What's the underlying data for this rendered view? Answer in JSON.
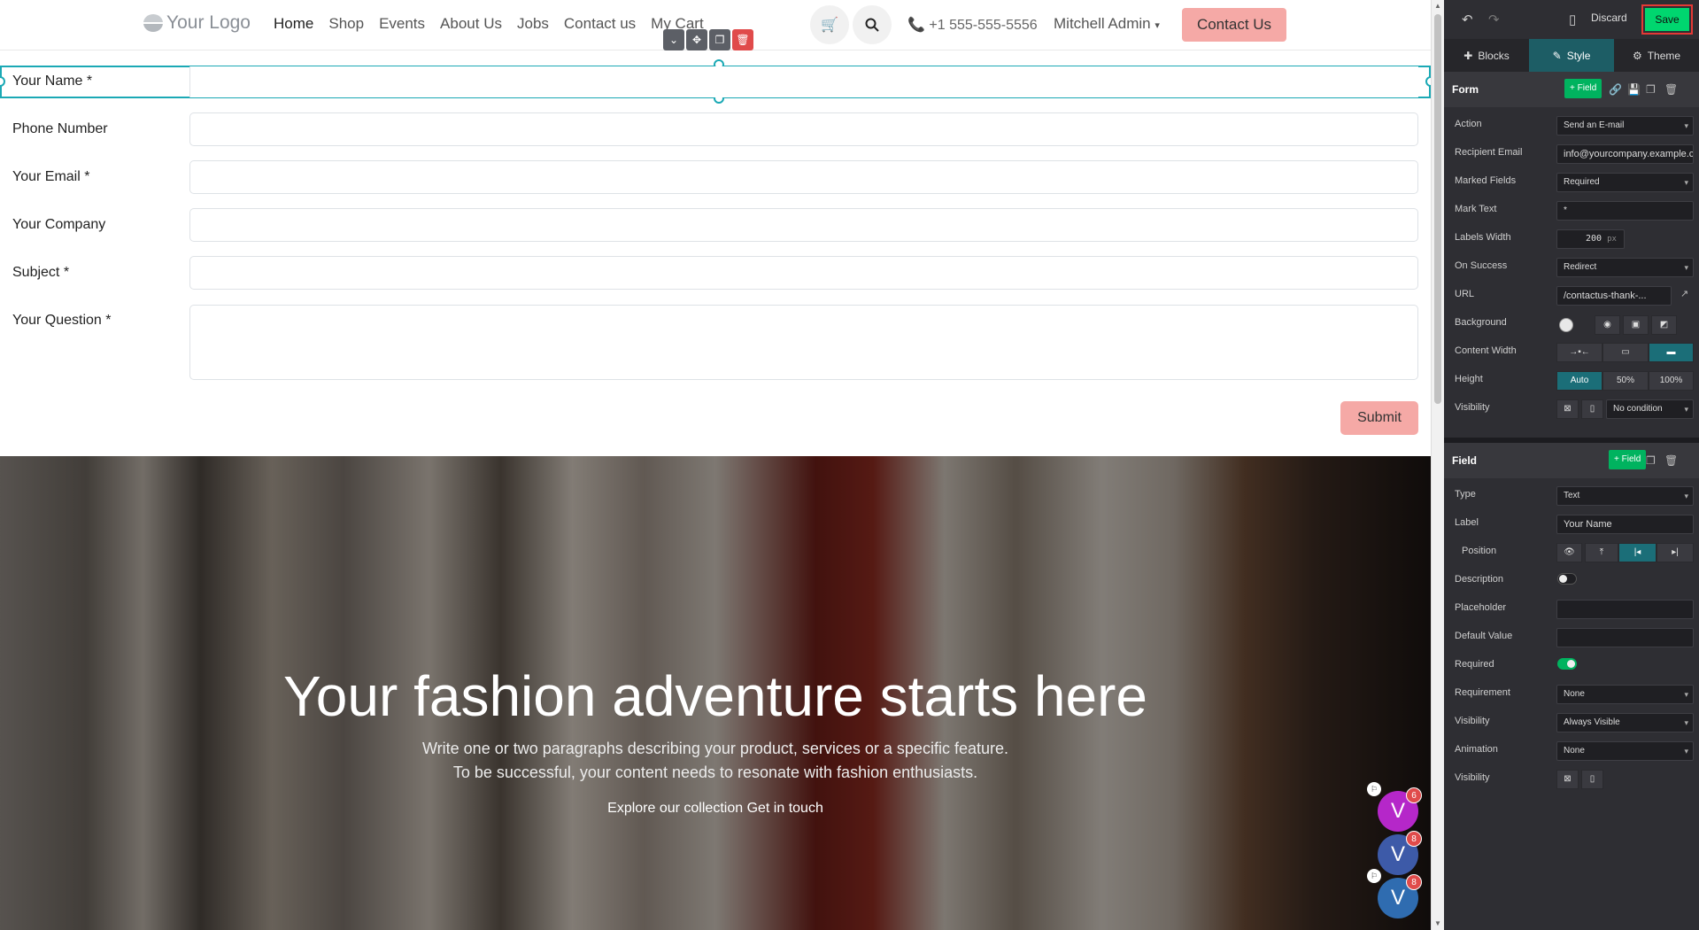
{
  "header": {
    "logo_text": "Your Logo",
    "nav": [
      "Home",
      "Shop",
      "Events",
      "About Us",
      "Jobs",
      "Contact us",
      "My Cart"
    ],
    "phone": "+1 555-555-5556",
    "user": "Mitchell Admin",
    "contact_button": "Contact Us"
  },
  "form": {
    "fields": [
      {
        "label": "Your Name *"
      },
      {
        "label": "Phone Number"
      },
      {
        "label": "Your Email *"
      },
      {
        "label": "Your Company"
      },
      {
        "label": "Subject *"
      },
      {
        "label": "Your Question *"
      }
    ],
    "submit_label": "Submit"
  },
  "hero": {
    "title": "Your fashion adventure starts here",
    "line1": "Write one or two paragraphs describing your product, services or a specific feature.",
    "line2": "To be successful, your content needs to resonate with fashion enthusiasts.",
    "link1": "Explore our collection",
    "link2": "Get in touch"
  },
  "avatars": [
    {
      "letter": "V",
      "count": "6",
      "color": "#b527c9"
    },
    {
      "letter": "V",
      "count": "8",
      "color": "#3d5aa8"
    },
    {
      "letter": "V",
      "count": "8",
      "color": "#2f6cb0"
    }
  ],
  "editor": {
    "discard": "Discard",
    "save": "Save",
    "tabs": {
      "blocks": "Blocks",
      "style": "Style",
      "theme": "Theme"
    },
    "form_section": {
      "title": "Form",
      "add_field": "+ Field",
      "action_label": "Action",
      "action_value": "Send an E-mail",
      "recipient_label": "Recipient Email",
      "recipient_value": "info@yourcompany.example.com",
      "marked_label": "Marked Fields",
      "marked_value": "Required",
      "mark_text_label": "Mark Text",
      "mark_text_value": "*",
      "labels_width_label": "Labels Width",
      "labels_width_value": "200",
      "labels_width_unit": "px",
      "on_success_label": "On Success",
      "on_success_value": "Redirect",
      "url_label": "URL",
      "url_value": "/contactus-thank-...",
      "background_label": "Background",
      "content_width_label": "Content Width",
      "height_label": "Height",
      "height_options": [
        "Auto",
        "50%",
        "100%"
      ],
      "visibility_label": "Visibility",
      "visibility_value": "No condition"
    },
    "field_section": {
      "title": "Field",
      "add_field": "+ Field",
      "type_label": "Type",
      "type_value": "Text",
      "label_label": "Label",
      "label_value": "Your Name",
      "position_label": "Position",
      "description_label": "Description",
      "placeholder_label": "Placeholder",
      "default_label": "Default Value",
      "required_label": "Required",
      "requirement_label": "Requirement",
      "requirement_value": "None",
      "visibility_label": "Visibility",
      "visibility_value": "Always Visible",
      "animation_label": "Animation",
      "animation_value": "None",
      "visibility2_label": "Visibility"
    }
  }
}
